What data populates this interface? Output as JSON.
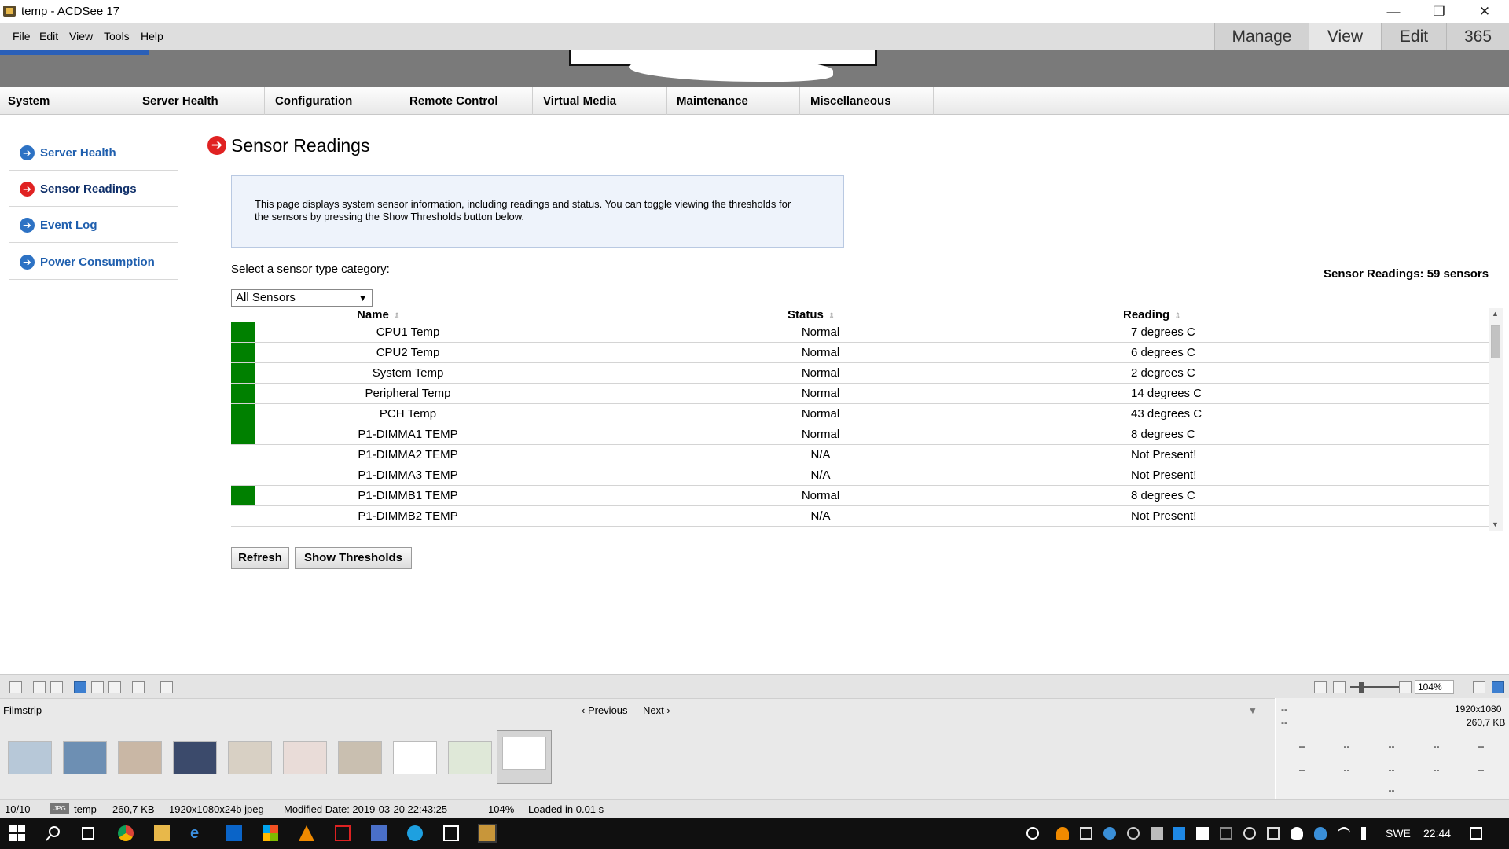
{
  "window": {
    "title": "temp - ACDSee 17",
    "controls": {
      "minimize": "—",
      "restore": "❐",
      "close": "✕"
    }
  },
  "menu": {
    "items": [
      "File",
      "Edit",
      "View",
      "Tools",
      "Help"
    ],
    "modes": [
      "Manage",
      "View",
      "Edit",
      "365"
    ]
  },
  "web": {
    "nav_tabs": [
      "System",
      "Server Health",
      "Configuration",
      "Remote Control",
      "Virtual Media",
      "Maintenance",
      "Miscellaneous"
    ],
    "sidebar": [
      {
        "label": "Server Health",
        "icon": "arrow-circle-icon",
        "active": false
      },
      {
        "label": "Sensor Readings",
        "icon": "arrow-circle-icon",
        "active": true
      },
      {
        "label": "Event Log",
        "icon": "arrow-circle-icon",
        "active": false
      },
      {
        "label": "Power Consumption",
        "icon": "arrow-circle-icon",
        "active": false
      }
    ],
    "page_title": "Sensor Readings",
    "info_text": "This page displays system sensor information, including readings and status. You can toggle viewing the thresholds for the sensors by pressing the Show Thresholds button below.",
    "select_label": "Select a sensor type category:",
    "sensor_count": "Sensor Readings: 59 sensors",
    "select_value": "All Sensors",
    "columns": {
      "name": "Name",
      "status": "Status",
      "reading": "Reading"
    },
    "rows": [
      {
        "name": "CPU1 Temp",
        "status": "Normal",
        "reading": "7 degrees C",
        "ok": true
      },
      {
        "name": "CPU2 Temp",
        "status": "Normal",
        "reading": "6 degrees C",
        "ok": true
      },
      {
        "name": "System Temp",
        "status": "Normal",
        "reading": "2 degrees C",
        "ok": true
      },
      {
        "name": "Peripheral Temp",
        "status": "Normal",
        "reading": "14 degrees C",
        "ok": true
      },
      {
        "name": "PCH Temp",
        "status": "Normal",
        "reading": "43 degrees C",
        "ok": true
      },
      {
        "name": "P1-DIMMA1 TEMP",
        "status": "Normal",
        "reading": "8 degrees C",
        "ok": true
      },
      {
        "name": "P1-DIMMA2 TEMP",
        "status": "N/A",
        "reading": "Not Present!",
        "ok": false
      },
      {
        "name": "P1-DIMMA3 TEMP",
        "status": "N/A",
        "reading": "Not Present!",
        "ok": false
      },
      {
        "name": "P1-DIMMB1 TEMP",
        "status": "Normal",
        "reading": "8 degrees C",
        "ok": true
      },
      {
        "name": "P1-DIMMB2 TEMP",
        "status": "N/A",
        "reading": "Not Present!",
        "ok": false
      }
    ],
    "buttons": {
      "refresh": "Refresh",
      "thresholds": "Show Thresholds"
    }
  },
  "toolbar": {
    "zoom": "104%"
  },
  "filmstrip": {
    "title": "Filmstrip",
    "previous": "Previous",
    "next": "Next",
    "thumbnail_count": 10
  },
  "properties": {
    "dimensions": "1920x1080",
    "size": "260,7 KB",
    "placeholder": "--"
  },
  "status": {
    "position": "10/10",
    "badge": "JPG",
    "name": "temp",
    "size": "260,7 KB",
    "format": "1920x1080x24b jpeg",
    "modified": "Modified Date: 2019-03-20 22:43:25",
    "zoom": "104%",
    "loaded": "Loaded in 0.01 s"
  },
  "taskbar": {
    "lang": "SWE",
    "time": "22:44"
  },
  "colors": {
    "ok_swatch": "#008000",
    "accent_blue": "#2d72c4",
    "accent_red": "#e02222"
  }
}
